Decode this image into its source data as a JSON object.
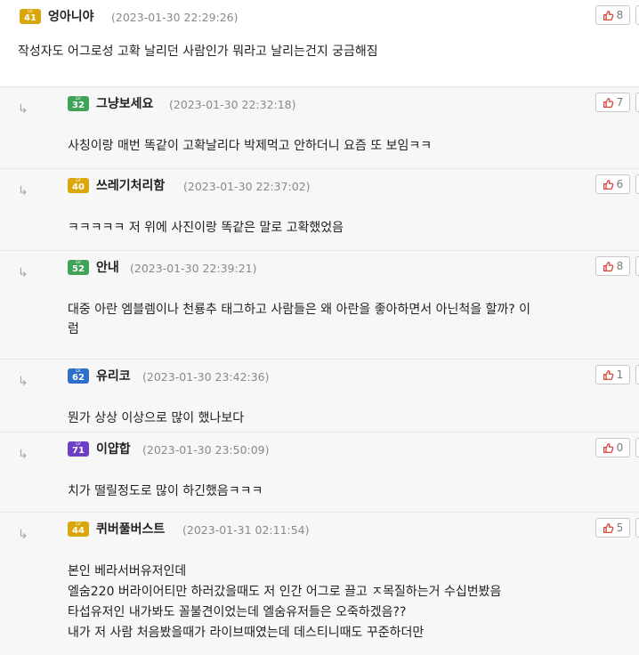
{
  "colors": {
    "lv_gold": "#d9a70a",
    "lv_green": "#41a35a",
    "lv_blue": "#2f6fc9",
    "lv_purple": "#6d3fc4",
    "like_icon": "#d7473a"
  },
  "icons": {
    "reply": "reply-arrow-icon",
    "like": "thumbs-up-icon",
    "level": "level-badge-icon"
  },
  "level_badge_prefix": "LV",
  "comments": [
    {
      "nick": "엉아니야",
      "level": "41",
      "date": "(2023-01-30 22:29:26)",
      "likes": "8",
      "lines": [
        "작성자도 어그로성 고확 날리던 사람인가 뭐라고 날리는건지 궁금해짐"
      ]
    },
    {
      "nick": "그냥보세요",
      "level": "32",
      "date": "(2023-01-30 22:32:18)",
      "likes": "7",
      "lines": [
        "사칭이랑 매번 똑같이 고확날리다 박제먹고 안하더니 요즘 또 보임ㅋㅋ"
      ]
    },
    {
      "nick": "쓰레기처리함",
      "level": "40",
      "date": "(2023-01-30 22:37:02)",
      "likes": "6",
      "lines": [
        "ㅋㅋㅋㅋㅋ  저 위에 사진이랑 똑같은 말로 고확했었음"
      ]
    },
    {
      "nick": "안내",
      "level": "52",
      "date": "(2023-01-30 22:39:21)",
      "likes": "8",
      "lines": [
        "대중 아란 엠블렘이나 천룡추 태그하고 사람들은 왜 아란을 좋아하면서 아닌척을 할까? 이",
        "럼"
      ]
    },
    {
      "nick": "유리코",
      "level": "62",
      "date": "(2023-01-30 23:42:36)",
      "likes": "1",
      "lines": [
        "뭔가 상상 이상으로 많이 했나보다"
      ]
    },
    {
      "nick": "이얍합",
      "level": "71",
      "date": "(2023-01-30 23:50:09)",
      "likes": "0",
      "lines": [
        "치가 떨릴정도로 많이 하긴했음ㅋㅋㅋ"
      ]
    },
    {
      "nick": "퀴버풀버스트",
      "level": "44",
      "date": "(2023-01-31 02:11:54)",
      "likes": "5",
      "lines": [
        "본인 베라서버유저인데",
        "엘숨220 버라이어티만 하러갔을때도 저 인간 어그로 끌고 ㅈ목질하는거 수십번봤음",
        "타섭유저인 내가봐도 꼴불견이었는데 엘숨유저들은 오죽하겠음??",
        "내가 저 사람 처음봤을때가 라이브때였는데 데스티니때도 꾸준하더만"
      ]
    }
  ]
}
